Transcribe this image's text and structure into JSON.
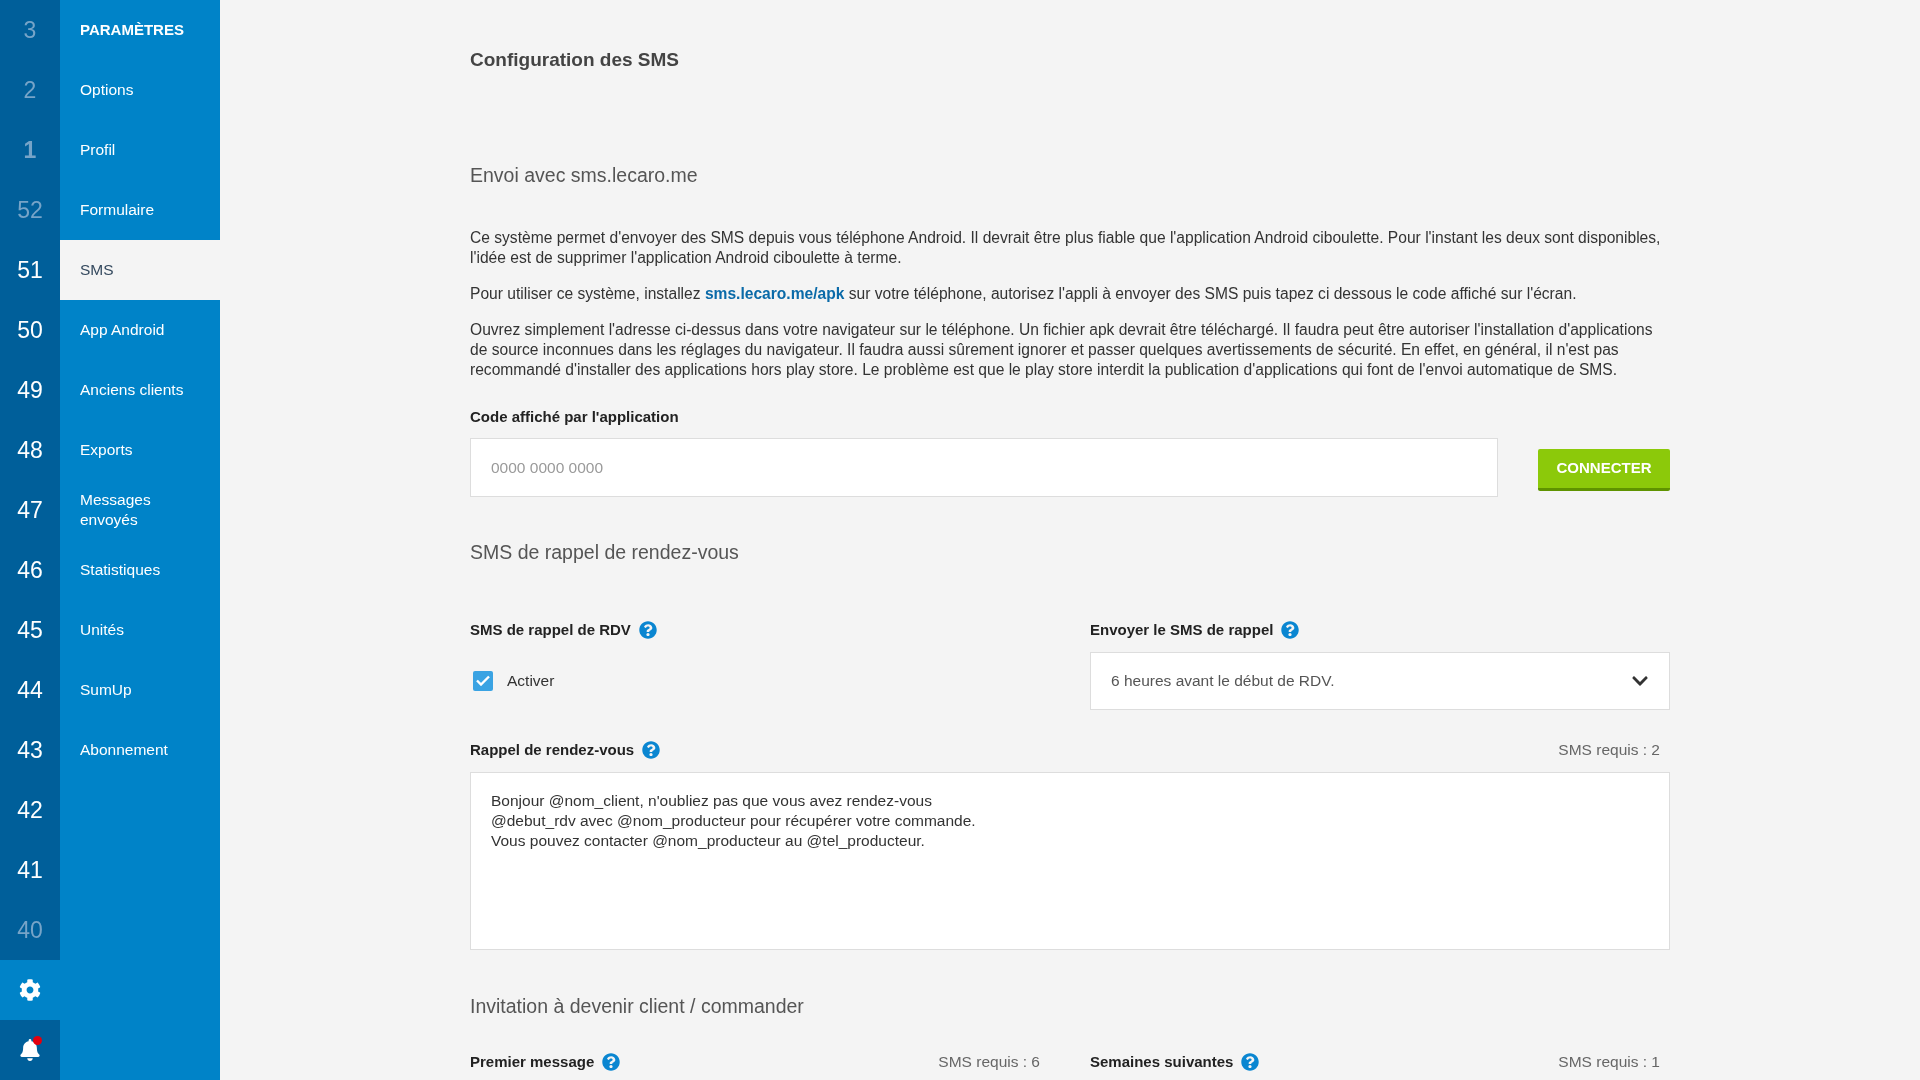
{
  "week_column": {
    "items": [
      {
        "label": "3",
        "faded": true,
        "current": false
      },
      {
        "label": "2",
        "faded": true,
        "current": false
      },
      {
        "label": "1",
        "faded": true,
        "current": true
      },
      {
        "label": "52",
        "faded": true,
        "current": false
      },
      {
        "label": "51",
        "faded": false,
        "current": false
      },
      {
        "label": "50",
        "faded": false,
        "current": false
      },
      {
        "label": "49",
        "faded": false,
        "current": false
      },
      {
        "label": "48",
        "faded": false,
        "current": false
      },
      {
        "label": "47",
        "faded": false,
        "current": false
      },
      {
        "label": "46",
        "faded": false,
        "current": false
      },
      {
        "label": "45",
        "faded": false,
        "current": false
      },
      {
        "label": "44",
        "faded": false,
        "current": false
      },
      {
        "label": "43",
        "faded": false,
        "current": false
      },
      {
        "label": "42",
        "faded": false,
        "current": false
      },
      {
        "label": "41",
        "faded": false,
        "current": false
      },
      {
        "label": "40",
        "faded": true,
        "current": false
      }
    ],
    "tools": [
      {
        "kind": "settings",
        "selected": true,
        "alert": false
      },
      {
        "kind": "notifications",
        "selected": false,
        "alert": true
      }
    ]
  },
  "nav": {
    "title": "PARAMÈTRES",
    "items": [
      {
        "label": "Options",
        "selected": false
      },
      {
        "label": "Profil",
        "selected": false
      },
      {
        "label": "Formulaire",
        "selected": false
      },
      {
        "label": "SMS",
        "selected": true
      },
      {
        "label": "App Android",
        "selected": false
      },
      {
        "label": "Anciens clients",
        "selected": false
      },
      {
        "label": "Exports",
        "selected": false
      },
      {
        "label": "Messages envoyés",
        "selected": false
      },
      {
        "label": "Statistiques",
        "selected": false
      },
      {
        "label": "Unités",
        "selected": false
      },
      {
        "label": "SumUp",
        "selected": false
      },
      {
        "label": "Abonnement",
        "selected": false
      }
    ]
  },
  "main": {
    "title": "Configuration des SMS",
    "gateway": {
      "heading": "Envoi avec sms.lecaro.me",
      "paragraphs": [
        {
          "kind": "plain",
          "text": "Ce système permet d'envoyer des SMS depuis vous téléphone Android. Il devrait être plus fiable que l'application Android ciboulette. Pour l'instant les deux sont disponibles, l'idée est de supprimer l'application Android ciboulette à terme."
        },
        {
          "kind": "with_link",
          "before": "Pour utiliser ce système, installez",
          "link": "sms.lecaro.me/apk",
          "after": "sur votre téléphone, autorisez l'appli à envoyer des SMS puis tapez ci dessous le code affiché sur l'écran."
        },
        {
          "kind": "plain",
          "text": "Ouvrez simplement l'adresse ci-dessus dans votre navigateur sur le téléphone. Un fichier apk devrait être téléchargé. Il faudra peut être autoriser l'installation d'applications de source inconnues dans les réglages du navigateur. Il faudra aussi sûrement ignorer et passer quelques avertissements de sécurité. En effet, en général, il n'est pas recommandé d'installer des applications hors play store. Le problème est que le play store interdit la publication d'applications qui font de l'envoi automatique de SMS."
        }
      ],
      "code_field": {
        "label": "Code affiché par l'application",
        "placeholder": "0000 0000 0000"
      },
      "connect_button": "CONNECTER"
    },
    "reminder": {
      "heading": "SMS de rappel de rendez-vous",
      "toggle": {
        "label": "SMS de rappel de RDV",
        "help": true,
        "option": "Activer",
        "checked": true
      },
      "timing": {
        "label": "Envoyer le SMS de rappel",
        "help": true,
        "value": "6 heures avant le début de RDV."
      },
      "message": {
        "label": "Rappel de rendez-vous",
        "help": true,
        "count": "SMS requis : 2",
        "lines": [
          "Bonjour @nom_client, n'oubliez pas que vous avez rendez-vous",
          "@debut_rdv avec @nom_producteur pour récupérer votre commande.",
          "Vous pouvez contacter @nom_producteur au @tel_producteur."
        ]
      }
    },
    "invitation": {
      "heading": "Invitation à devenir client / commander",
      "fields": [
        {
          "label": "Premier message",
          "help": true,
          "count": "SMS requis : 6"
        },
        {
          "label": "Semaines suivantes",
          "help": true,
          "count": "SMS requis : 1"
        }
      ]
    }
  }
}
